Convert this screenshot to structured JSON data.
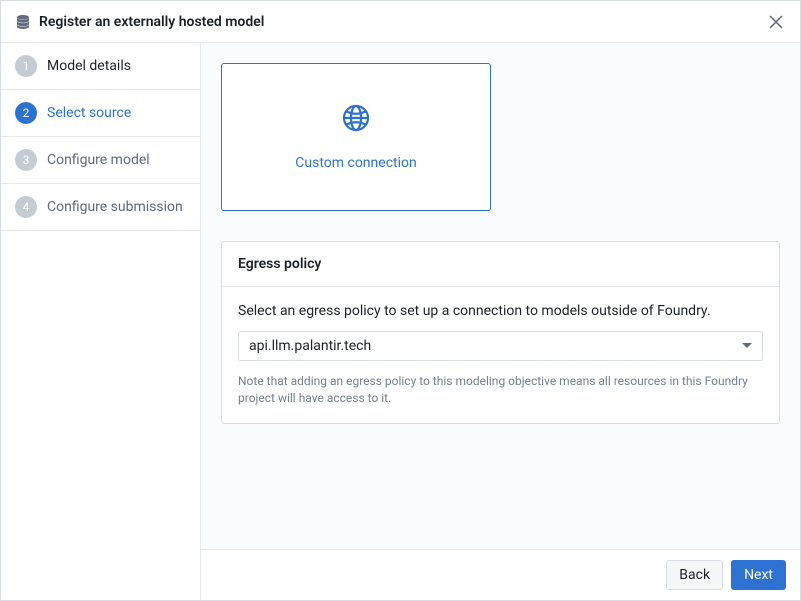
{
  "header": {
    "title": "Register an externally hosted model"
  },
  "steps": [
    {
      "num": "1",
      "label": "Model details"
    },
    {
      "num": "2",
      "label": "Select source"
    },
    {
      "num": "3",
      "label": "Configure model"
    },
    {
      "num": "4",
      "label": "Configure submission"
    }
  ],
  "source_card": {
    "label": "Custom connection"
  },
  "egress": {
    "title": "Egress policy",
    "description": "Select an egress policy to set up a connection to models outside of Foundry.",
    "selected": "api.llm.palantir.tech",
    "note": "Note that adding an egress policy to this modeling objective means all resources in this Foundry project will have access to it."
  },
  "footer": {
    "back": "Back",
    "next": "Next"
  }
}
